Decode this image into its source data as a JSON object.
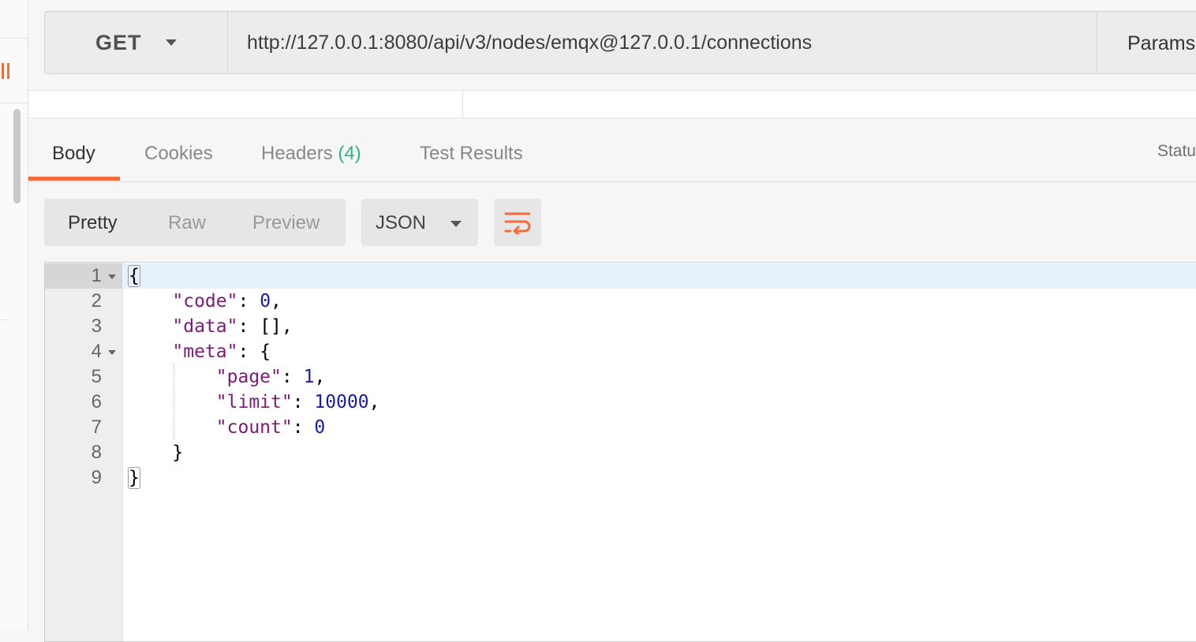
{
  "request": {
    "method": "GET",
    "url": "http://127.0.0.1:8080/api/v3/nodes/emqx@127.0.0.1/connections",
    "params_label": "Params"
  },
  "response_tabs": {
    "body": "Body",
    "cookies": "Cookies",
    "headers": "Headers",
    "headers_count": "(4)",
    "test_results": "Test Results",
    "status_label": "Statu"
  },
  "format": {
    "pretty": "Pretty",
    "raw": "Raw",
    "preview": "Preview",
    "language": "JSON"
  },
  "editor": {
    "lines": [
      {
        "no": "1",
        "fold": true
      },
      {
        "no": "2",
        "fold": false
      },
      {
        "no": "3",
        "fold": false
      },
      {
        "no": "4",
        "fold": true
      },
      {
        "no": "5",
        "fold": false
      },
      {
        "no": "6",
        "fold": false
      },
      {
        "no": "7",
        "fold": false
      },
      {
        "no": "8",
        "fold": false
      },
      {
        "no": "9",
        "fold": false
      }
    ],
    "open_brace": "{",
    "close_brace": "}",
    "code_key": "\"code\"",
    "code_value": "0",
    "data_key": "\"data\"",
    "data_value": "[]",
    "meta_key": "\"meta\"",
    "page_key": "\"page\"",
    "page_value": "1",
    "limit_key": "\"limit\"",
    "limit_value": "10000",
    "count_key": "\"count\"",
    "count_value": "0"
  },
  "colors": {
    "accent": "#f26b3a",
    "count_green": "#2eb67d",
    "json_key": "#7d1a78",
    "json_number": "#1a1aa6"
  },
  "icons": {
    "wrap": "text-wrap-icon",
    "dropdown": "chevron-down-icon"
  }
}
